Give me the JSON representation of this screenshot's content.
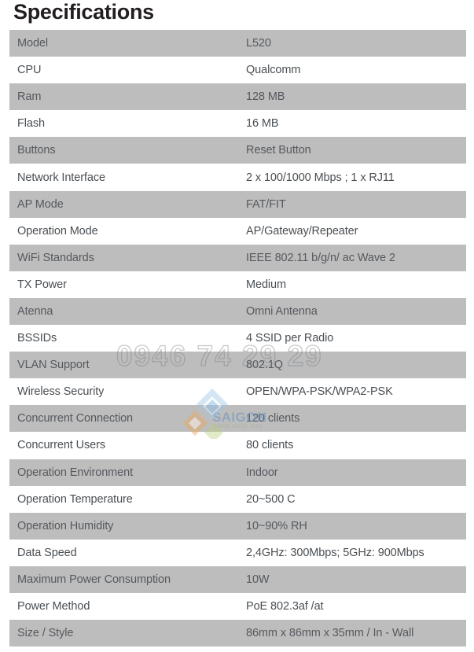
{
  "page": {
    "title": "Specifications",
    "shaded_row_color": "#bdbdbd",
    "plain_row_color": "#ffffff",
    "text_color": "#4a4f54",
    "title_color": "#231f20"
  },
  "spec_table": {
    "rows": [
      {
        "label": "Model",
        "value": "L520",
        "shaded": true
      },
      {
        "label": "CPU",
        "value": "Qualcomm",
        "shaded": false
      },
      {
        "label": "Ram",
        "value": "128 MB",
        "shaded": true
      },
      {
        "label": "Flash",
        "value": "16 MB",
        "shaded": false
      },
      {
        "label": "Buttons",
        "value": "Reset Button",
        "shaded": true
      },
      {
        "label": "Network Interface",
        "value": "2 x 100/1000 Mbps ; 1 x RJ11",
        "shaded": false
      },
      {
        "label": "AP Mode",
        "value": "FAT/FIT",
        "shaded": true
      },
      {
        "label": "Operation Mode",
        "value": "AP/Gateway/Repeater",
        "shaded": false
      },
      {
        "label": "WiFi Standards",
        "value": "IEEE 802.11 b/g/n/ ac Wave 2",
        "shaded": true
      },
      {
        "label": "TX Power",
        "value": "Medium",
        "shaded": false
      },
      {
        "label": "Atenna",
        "value": "Omni Antenna",
        "shaded": true
      },
      {
        "label": "BSSIDs",
        "value": "4 SSID per Radio",
        "shaded": false
      },
      {
        "label": "VLAN Support",
        "value": "802.1Q",
        "shaded": true
      },
      {
        "label": "Wireless Security",
        "value": "OPEN/WPA-PSK/WPA2-PSK",
        "shaded": false
      },
      {
        "label": "Concurrent Connection",
        "value": "120 clients",
        "shaded": true
      },
      {
        "label": "Concurrent Users",
        "value": "80 clients",
        "shaded": false
      },
      {
        "label": "Operation Environment",
        "value": "Indoor",
        "shaded": true
      },
      {
        "label": "Operation Temperature",
        "value": "20~500 C",
        "shaded": false
      },
      {
        "label": "Operation Humidity",
        "value": "10~90% RH",
        "shaded": true
      },
      {
        "label": "Data Speed",
        "value": "2,4GHz: 300Mbps; 5GHz: 900Mbps",
        "shaded": false
      },
      {
        "label": "Maximum Power Consumption",
        "value": "10W",
        "shaded": true
      },
      {
        "label": "Power Method",
        "value": "PoE 802.3af /at",
        "shaded": false
      },
      {
        "label": "Size / Style",
        "value": "86mm x 86mm x 35mm / In - Wall",
        "shaded": true
      }
    ]
  },
  "watermark": {
    "phone": "0946 74 29 29",
    "brand": "SAIGON",
    "brand_sub": "CONG NGHE CAO",
    "logo_blue": "#9cc4e4",
    "logo_orange": "#e8a860",
    "logo_green": "#b5cf7a"
  }
}
